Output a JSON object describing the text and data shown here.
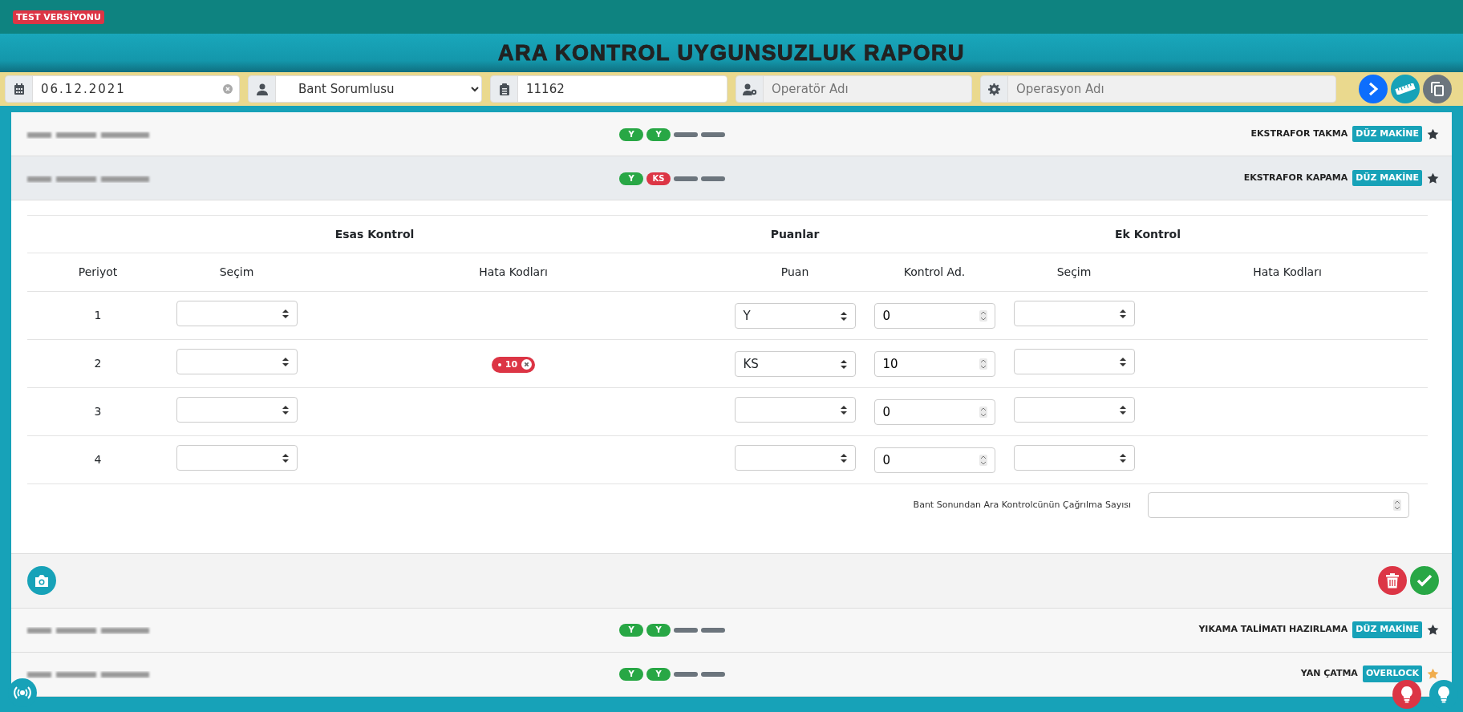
{
  "test_badge": "TEST VERSİYONU",
  "title": "ARA KONTROL UYGUNSUZLUK RAPORU",
  "filters": [
    {
      "kind": "date",
      "value": "06.12.2021"
    },
    {
      "kind": "select",
      "value": "Bant Sorumlusu"
    },
    {
      "kind": "text",
      "value": "11162"
    },
    {
      "kind": "text",
      "placeholder": "Operatör Adı"
    },
    {
      "kind": "text",
      "placeholder": "Operasyon Adı"
    }
  ],
  "operations": [
    {
      "expanded": false,
      "operation": "EKSTRAFOR TAKMA",
      "machine": "DÜZ MAKİNE",
      "color": "#343a40",
      "periods": [
        {
          "kind": "pass",
          "label": "Y"
        },
        {
          "kind": "pass",
          "label": "Y"
        },
        {
          "kind": "empty"
        },
        {
          "kind": "empty"
        }
      ]
    },
    {
      "expanded": true,
      "operation": "EKSTRAFOR KAPAMA",
      "machine": "DÜZ MAKİNE",
      "color": "#343a40",
      "periods": [
        {
          "kind": "pass",
          "label": "Y"
        },
        {
          "kind": "fail",
          "label": "KS"
        },
        {
          "kind": "empty"
        },
        {
          "kind": "empty"
        }
      ]
    },
    {
      "expanded": false,
      "operation": "YIKAMA TALİMATI HAZIRLAMA",
      "machine": "DÜZ MAKİNE",
      "color": "#343a40",
      "periods": [
        {
          "kind": "pass",
          "label": "Y"
        },
        {
          "kind": "pass",
          "label": "Y"
        },
        {
          "kind": "empty"
        },
        {
          "kind": "empty"
        }
      ]
    },
    {
      "expanded": false,
      "operation": "YAN ÇATMA",
      "machine": "OVERLOCK",
      "color": "#f0ad4e",
      "periods": [
        {
          "kind": "pass",
          "label": "Y"
        },
        {
          "kind": "pass",
          "label": "Y"
        },
        {
          "kind": "empty"
        },
        {
          "kind": "empty"
        }
      ]
    }
  ],
  "detail": {
    "groups": [
      "Esas Kontrol",
      "Puanlar",
      "Ek Kontrol"
    ],
    "columns": [
      "Periyot",
      "Seçim",
      "Hata Kodları",
      "Puan",
      "Kontrol Ad.",
      "Seçim",
      "Hata Kodları"
    ],
    "rows": [
      {
        "period": "1",
        "puan": "Y",
        "count": "0",
        "error_codes": []
      },
      {
        "period": "2",
        "puan": "KS",
        "count": "10",
        "error_codes": [
          "10"
        ]
      },
      {
        "period": "3",
        "count": "0",
        "error_codes": []
      },
      {
        "period": "4",
        "count": "0",
        "error_codes": []
      }
    ],
    "footer_label": "Bant Sonundan Ara Kontrolcünün Çağrılma Sayısı"
  }
}
